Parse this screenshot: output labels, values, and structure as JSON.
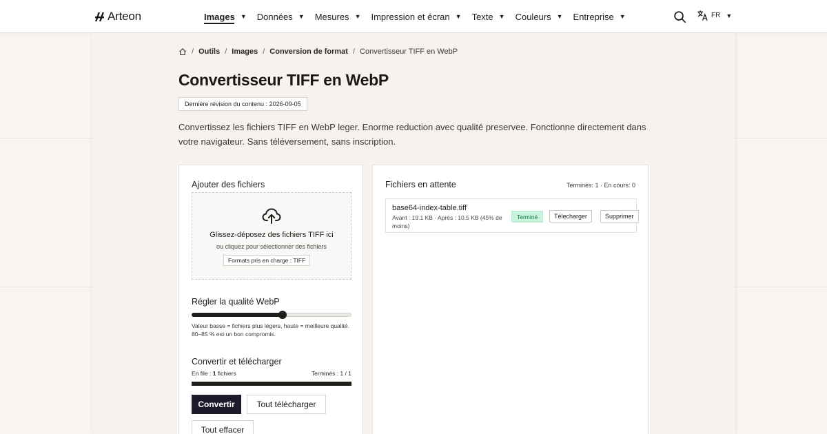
{
  "header": {
    "brand": "Arteon",
    "nav": [
      {
        "label": "Images",
        "active": true
      },
      {
        "label": "Données",
        "active": false
      },
      {
        "label": "Mesures",
        "active": false
      },
      {
        "label": "Impression et écran",
        "active": false
      },
      {
        "label": "Texte",
        "active": false
      },
      {
        "label": "Couleurs",
        "active": false
      },
      {
        "label": "Entreprise",
        "active": false
      }
    ],
    "search_icon": "search-icon",
    "language": "FR",
    "language_icon": "translate-icon"
  },
  "breadcrumb": {
    "home_icon": "home-icon",
    "items": [
      "Outils",
      "Images",
      "Conversion de format"
    ],
    "current": "Convertisseur TIFF en WebP"
  },
  "page": {
    "title": "Convertisseur TIFF en WebP",
    "revision": "Dernière révision du contenu : 2026-09-05",
    "intro": "Convertissez les fichiers TIFF en WebP leger. Enorme reduction avec qualité preservee. Fonctionne directement dans votre navigateur. Sans téléversement, sans inscription."
  },
  "upload": {
    "title": "Ajouter des fichiers",
    "icon": "cloud-upload-icon",
    "main_text": "Glissez-déposez des fichiers TIFF ici",
    "sub_text": "ou cliquez pour sélectionner des fichiers",
    "formats": "Formats pris en charge : TIFF"
  },
  "quality": {
    "title": "Régler la qualité WebP",
    "value_fraction": 0.57,
    "help": "Valeur basse = fichiers plus légers, haute = meilleure qualité. 80–85 % est un bon compromis."
  },
  "convert": {
    "title": "Convertir et télécharger",
    "queue_prefix": "En file : ",
    "queue_count": "1",
    "queue_suffix": " fichiers",
    "done": "Terminés : 1 / 1",
    "progress_fraction": 1.0,
    "convert_button": "Convertir",
    "download_all_button": "Tout télécharger",
    "clear_all_button": "Tout effacer"
  },
  "pending": {
    "title": "Fichiers en attente",
    "stats": "Terminés: 1 · En cours: 0",
    "files": [
      {
        "name": "base64-index-table.tiff",
        "meta": "Avant : 19.1 KB · Après : 10.5 KB (45% de moins)",
        "status": "Terminé",
        "download_label": "Télecharger",
        "delete_label": "Supprimer"
      }
    ]
  },
  "colors": {
    "primary": "#1c1b2b",
    "status_done_bg": "#c8f3dd",
    "status_done_text": "#157a46"
  }
}
